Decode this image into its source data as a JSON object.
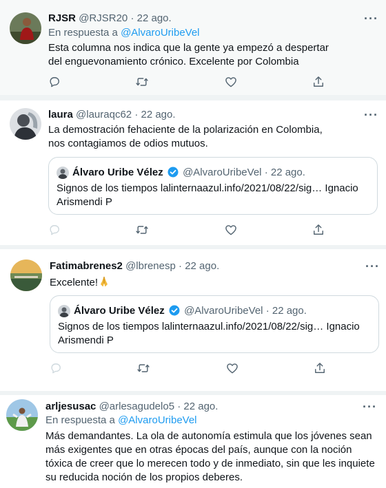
{
  "tweets": [
    {
      "name": "RJSR",
      "handle": "@RJSR20",
      "dot": "·",
      "date": "22 ago.",
      "reply_prefix": "En respuesta a",
      "reply_to": "@AlvaroUribeVel",
      "text": "Esta columna nos indica que la gente ya empezó a despertar del enguevonamiento crónico. Excelente por Colombia",
      "more": "···",
      "avatar_icon": "person-photo-icon"
    },
    {
      "name": "laura",
      "handle": "@lauraqc62",
      "dot": "·",
      "date": "22 ago.",
      "text": "La demostración fehaciente de la polarización en Colombia, nos contagiamos de odios mutuos.",
      "more": "···",
      "quote": {
        "name": "Álvaro Uribe Vélez",
        "handle": "@AlvaroUribeVel",
        "dot": "·",
        "date": "22 ago.",
        "text": "Signos de los tiempos lalinternaazul.info/2021/08/22/sig… Ignacio Arismendi P"
      }
    },
    {
      "name": "Fatimabrenes2",
      "handle": "@lbrenesp",
      "dot": "·",
      "date": "22 ago.",
      "text": "Excelente!",
      "emoji": "folded-hands-emoji",
      "more": "···",
      "quote": {
        "name": "Álvaro Uribe Vélez",
        "handle": "@AlvaroUribeVel",
        "dot": "·",
        "date": "22 ago.",
        "text": "Signos de los tiempos lalinternaazul.info/2021/08/22/sig… Ignacio Arismendi P"
      }
    },
    {
      "name": "arljesusac",
      "handle": "@arlesagudelo5",
      "dot": "·",
      "date": "22 ago.",
      "reply_prefix": "En respuesta a",
      "reply_to": "@AlvaroUribeVel",
      "text": "Más demandantes. La ola de autonomía estimula que los jóvenes sean más exigentes que en otras épocas del país, aunque con la noción tóxica de creer que lo merecen todo y de inmediato, sin que les inquiete su reducida noción de los propios deberes.",
      "more": "···"
    }
  ],
  "actions": [
    "reply-icon",
    "retweet-icon",
    "like-icon",
    "share-icon"
  ],
  "colors": {
    "link": "#1d9bf0",
    "secondary": "#536471",
    "verified": "#1d9bf0",
    "highlight_bg": "#f7f9f9"
  }
}
